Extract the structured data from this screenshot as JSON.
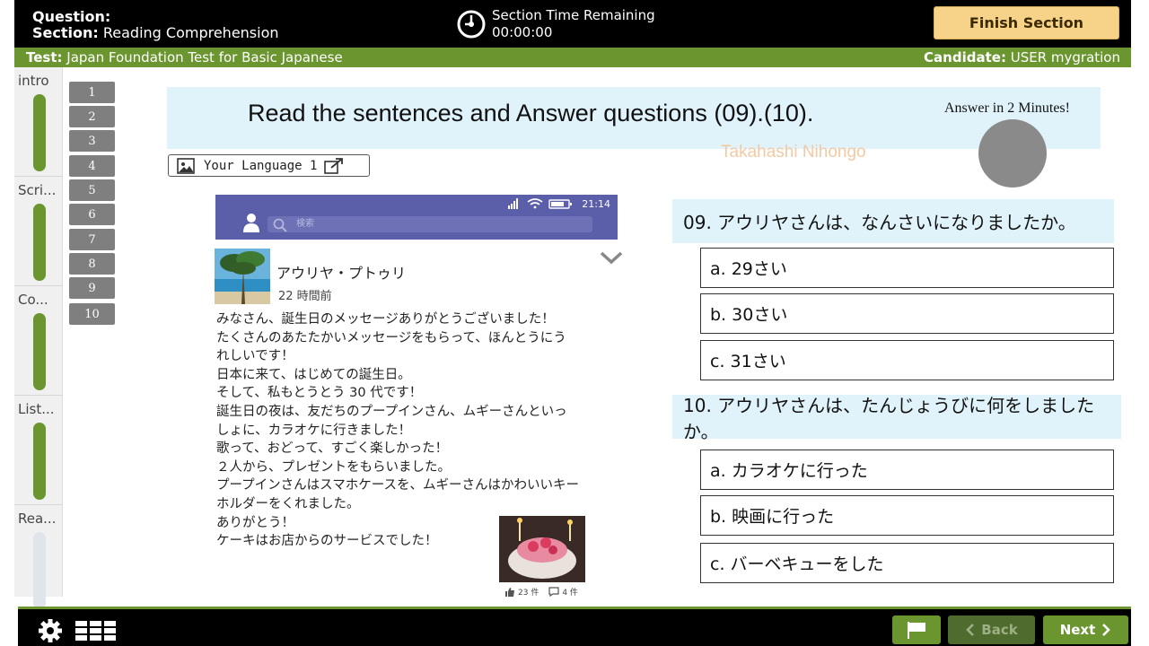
{
  "header": {
    "question_label": "Question:",
    "section_label": "Section:",
    "section_value": "Reading Comprehension",
    "timer_title": "Section Time Remaining",
    "timer_value": "00:00:00",
    "finish_label": "Finish Section"
  },
  "infobar": {
    "test_label": "Test:",
    "test_value": "Japan Foundation Test for Basic Japanese",
    "candidate_label": "Candidate:",
    "candidate_value": "USER mygration"
  },
  "sections": [
    {
      "label": "intro",
      "progress": 1.0
    },
    {
      "label": "Scri...",
      "progress": 1.0
    },
    {
      "label": "Co...",
      "progress": 1.0
    },
    {
      "label": "List...",
      "progress": 1.0
    },
    {
      "label": "Rea...",
      "progress": 0.0
    }
  ],
  "question_numbers": [
    "1",
    "2",
    "3",
    "4",
    "5",
    "6",
    "7",
    "8",
    "9",
    "10"
  ],
  "instruction": {
    "text": "Read the sentences and Answer questions (09).(10).",
    "answer_time": "Answer in 2 Minutes!",
    "watermark": "Takahashi Nihongo"
  },
  "language_button": "Your Language 1",
  "post": {
    "status_time": "21:14",
    "search_placeholder": "検索",
    "author": "アウリヤ・プトゥリ",
    "time_ago": "22 時間前",
    "lines": [
      "みなさん、誕生日のメッセージありがとうございました！",
      "たくさんのあたたかいメッセージをもらって、ほんとうにう",
      "れしいです！",
      "日本に来て、はじめての誕生日。",
      "そして、私もとうとう 30 代です！",
      "誕生日の夜は、友だちのプープインさん、ムギーさんといっ",
      "しょに、カラオケに行きました！",
      "歌って、おどって、すごく楽しかった！",
      "２人から、プレゼントをもらいました。",
      "プープインさんはスマホケースを、ムギーさんはかわいいキー",
      "ホルダーをくれました。",
      "ありがとう！",
      "ケーキはお店からのサービスでした！"
    ],
    "likes": "23 件",
    "comments": "4 件"
  },
  "questions": [
    {
      "text": "09. アウリヤさんは、なんさいになりましたか。",
      "options": [
        "a. 29さい",
        "b. 30さい",
        "c. 31さい"
      ]
    },
    {
      "text": "10. アウリヤさんは、たんじょうびに何をしましたか。",
      "options": [
        "a. カラオケに行った",
        "b. 映画に行った",
        "c. バーベキューをした"
      ]
    }
  ],
  "footer": {
    "back_label": "Back",
    "next_label": "Next"
  },
  "colors": {
    "accent_green": "#6a952f",
    "finish_button": "#f7d289",
    "header_black": "#000000",
    "instruction_bg": "#e0f2fa",
    "phone_bar": "#5b5ea8"
  }
}
